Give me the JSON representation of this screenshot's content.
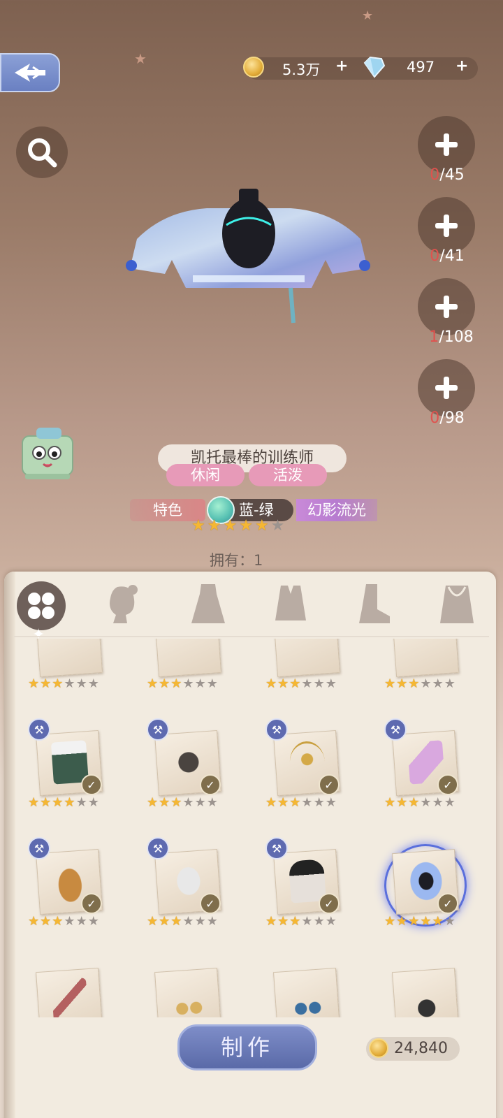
{
  "header": {
    "coins": "5.3万",
    "gems": "497",
    "plus": "+"
  },
  "materials": [
    {
      "owned": "0",
      "total": "/45"
    },
    {
      "owned": "0",
      "total": "/41"
    },
    {
      "owned": "1",
      "total": "/108"
    },
    {
      "owned": "0",
      "total": "/98"
    }
  ],
  "item": {
    "name": "凯托最棒的训练师",
    "tags": [
      "休闲",
      "活泼"
    ],
    "feature": "特色",
    "color": "蓝-绿",
    "series": "幻影流光",
    "stars": 5,
    "max_stars": 6,
    "owned_label": "拥有：1"
  },
  "grid": {
    "rows": [
      [
        {
          "stars": 3,
          "hammer": false,
          "check": false
        },
        {
          "stars": 3,
          "hammer": false,
          "check": false
        },
        {
          "stars": 3,
          "hammer": false,
          "check": false
        },
        {
          "stars": 3,
          "hammer": false,
          "check": false
        }
      ],
      [
        {
          "stars": 4,
          "hammer": true,
          "check": true
        },
        {
          "stars": 3,
          "hammer": true,
          "check": true
        },
        {
          "stars": 3,
          "hammer": true,
          "check": true
        },
        {
          "stars": 3,
          "hammer": true,
          "check": true
        }
      ],
      [
        {
          "stars": 3,
          "hammer": true,
          "check": true
        },
        {
          "stars": 3,
          "hammer": true,
          "check": true
        },
        {
          "stars": 3,
          "hammer": true,
          "check": true
        },
        {
          "stars": 5,
          "hammer": false,
          "check": true,
          "selected": true
        }
      ]
    ]
  },
  "actions": {
    "make_label": "制作",
    "cost": "24,840"
  },
  "colors": {
    "accent_blue": "#5e6ab0",
    "tag_pink": "#e79ab8",
    "star_gold": "#f5b733"
  }
}
